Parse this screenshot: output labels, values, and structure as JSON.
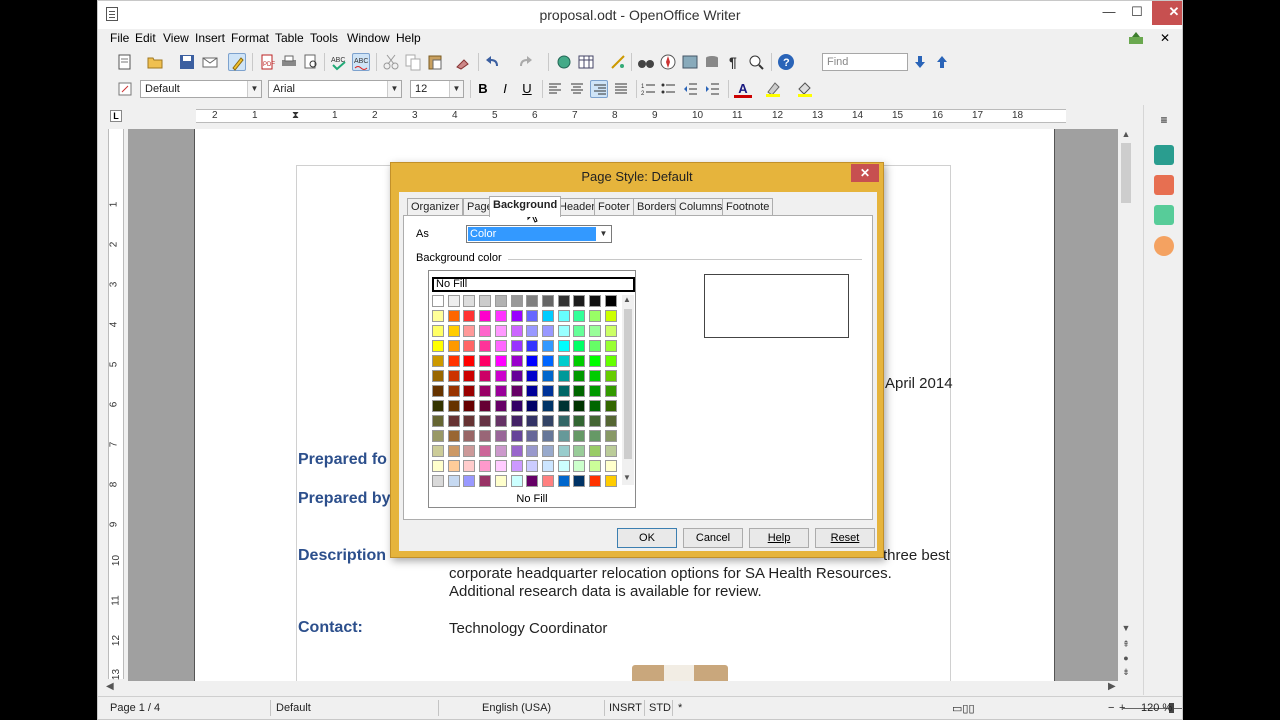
{
  "window": {
    "title": "proposal.odt - OpenOffice Writer",
    "min_label": "—",
    "max_label": "☐",
    "close_label": "✕"
  },
  "menu": {
    "items": [
      "File",
      "Edit",
      "View",
      "Insert",
      "Format",
      "Table",
      "Tools",
      "Window",
      "Help"
    ],
    "close_doc_label": "✕"
  },
  "toolbar": {
    "find_placeholder": "Find",
    "para_style": "Default",
    "font_name": "Arial",
    "font_size": "12",
    "bold_label": "B",
    "italic_label": "I",
    "underline_label": "U",
    "font_color_label": "A"
  },
  "ruler": {
    "h_numbers": [
      "2",
      "1",
      "1",
      "2",
      "3",
      "4",
      "5",
      "6",
      "7",
      "8",
      "9",
      "10",
      "11",
      "12",
      "13",
      "14",
      "15",
      "16",
      "17",
      "18"
    ],
    "v_numbers": [
      "1",
      "2",
      "3",
      "4",
      "5",
      "6",
      "7",
      "8",
      "9",
      "10",
      "11",
      "12",
      "13"
    ],
    "tab_stop_label": "L"
  },
  "document": {
    "date_text": "April 2014",
    "prepared_for_label": "Prepared fo",
    "prepared_by_label": "Prepared by",
    "description_label": "Description",
    "desc_line1_tail": "three best",
    "desc_line2": "corporate headquarter relocation options for SA Health Resources.",
    "desc_line3": "Additional research data is available for review.",
    "contact_label": "Contact:",
    "contact_value": "Technology Coordinator"
  },
  "dialog": {
    "title": "Page Style: Default",
    "close_label": "✕",
    "tabs": [
      "Organizer",
      "Page",
      "Background",
      "Header",
      "Footer",
      "Borders",
      "Columns",
      "Footnote"
    ],
    "selected_tab": "Background",
    "as_label": "As",
    "as_value": "Color",
    "bg_color_label": "Background color",
    "nofill_top": "No Fill",
    "nofill_bottom": "No Fill",
    "buttons": {
      "ok": "OK",
      "cancel": "Cancel",
      "help": "Help",
      "reset": "Reset"
    }
  },
  "palette": {
    "rows": [
      [
        "#ffffff",
        "#eeeeee",
        "#dddddd",
        "#cccccc",
        "#b2b2b2",
        "#999999",
        "#808080",
        "#666666",
        "#333333",
        "#1c1c1c",
        "#111111",
        "#000000"
      ],
      [
        "#ffff99",
        "#ff6600",
        "#ff3333",
        "#ff00cc",
        "#ff33ff",
        "#9900ff",
        "#6666ff",
        "#00ccff",
        "#66ffff",
        "#33ff99",
        "#99ff66",
        "#ccff00"
      ],
      [
        "#ffff66",
        "#ffcc00",
        "#ff9999",
        "#ff66cc",
        "#ff99ff",
        "#cc66ff",
        "#9999ff",
        "#9999ff",
        "#99ffff",
        "#66ff99",
        "#99ff99",
        "#ccff66"
      ],
      [
        "#ffff00",
        "#ff9900",
        "#ff6666",
        "#ff3399",
        "#ff66ff",
        "#9933ff",
        "#3333ff",
        "#3399ff",
        "#00ffff",
        "#00ff66",
        "#66ff66",
        "#99ff33"
      ],
      [
        "#cc9900",
        "#ff3300",
        "#ff0000",
        "#ff0066",
        "#ff00ff",
        "#9900cc",
        "#0000ff",
        "#0066ff",
        "#00cccc",
        "#00cc00",
        "#00ff00",
        "#66ff00"
      ],
      [
        "#996600",
        "#cc3300",
        "#cc0000",
        "#cc0066",
        "#cc00cc",
        "#660099",
        "#0000cc",
        "#0066cc",
        "#009999",
        "#009900",
        "#00cc00",
        "#66cc00"
      ],
      [
        "#663300",
        "#993300",
        "#990000",
        "#990066",
        "#990099",
        "#660066",
        "#000099",
        "#003399",
        "#006666",
        "#006600",
        "#009900",
        "#339900"
      ],
      [
        "#333300",
        "#663300",
        "#660000",
        "#660033",
        "#660066",
        "#330066",
        "#000066",
        "#003366",
        "#003333",
        "#003300",
        "#006600",
        "#336600"
      ],
      [
        "#666633",
        "#663333",
        "#663333",
        "#663344",
        "#663366",
        "#442266",
        "#333366",
        "#334466",
        "#336666",
        "#336633",
        "#446633",
        "#556633"
      ],
      [
        "#999966",
        "#996633",
        "#996666",
        "#996677",
        "#996699",
        "#664499",
        "#666699",
        "#667799",
        "#669999",
        "#669966",
        "#669966",
        "#889966"
      ],
      [
        "#cccc99",
        "#cc9966",
        "#cc9999",
        "#cc6699",
        "#cc99cc",
        "#9966cc",
        "#9999cc",
        "#99aacc",
        "#99cccc",
        "#99cc99",
        "#99cc66",
        "#bbcc99"
      ],
      [
        "#ffffcc",
        "#ffcc99",
        "#ffcccc",
        "#ff99cc",
        "#ffccff",
        "#cc99ff",
        "#ccccff",
        "#cce5ff",
        "#ccffff",
        "#ccffcc",
        "#ccff99",
        "#ffffcc"
      ],
      [
        "#d9d9d9",
        "#c6d9f1",
        "#9999ff",
        "#993366",
        "#ffffcc",
        "#ccffff",
        "#660066",
        "#ff8080",
        "#0066cc",
        "#003366",
        "#ff3300",
        "#ffcc00"
      ]
    ]
  },
  "status": {
    "page": "Page 1 / 4",
    "style": "Default",
    "language": "English (USA)",
    "insert_mode": "INSRT",
    "sel_mode": "STD",
    "modified": "*",
    "zoom": "120 %",
    "zoom_minus": "−",
    "zoom_plus": "+"
  }
}
